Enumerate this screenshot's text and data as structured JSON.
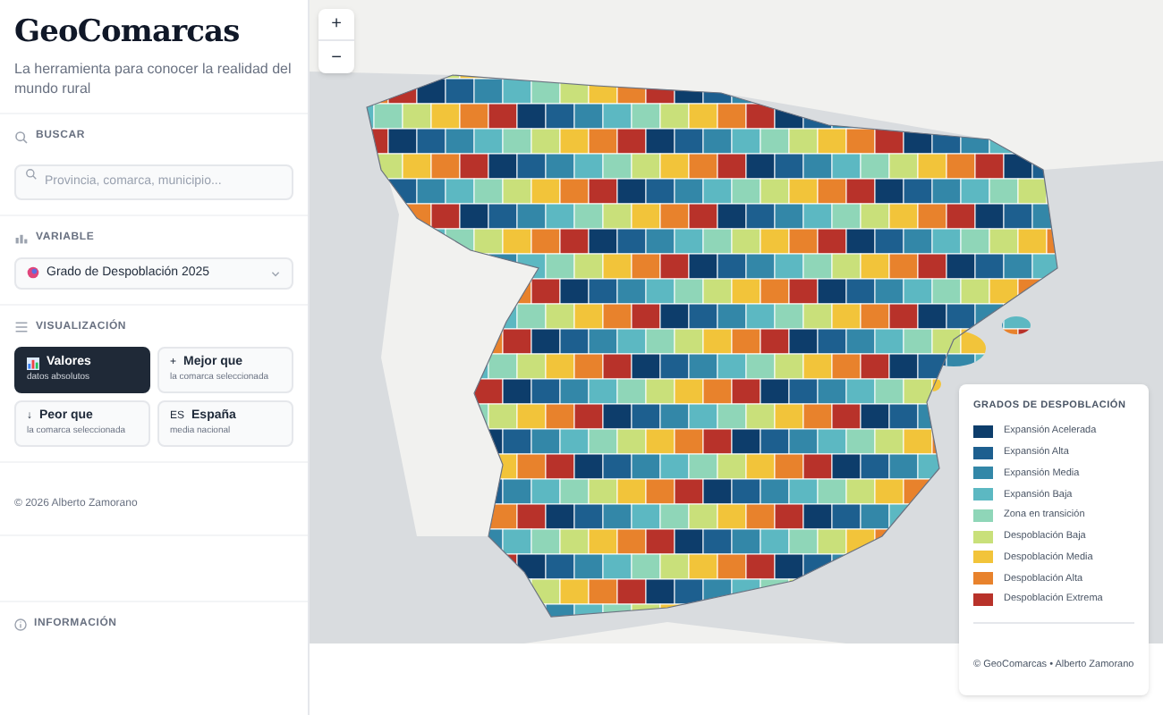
{
  "sidebar": {
    "title": "GeoComarcas",
    "subtitle": "La herramienta para conocer la realidad del mundo rural",
    "search": {
      "label": "BUSCAR",
      "placeholder": "Provincia, comarca, municipio..."
    },
    "variable": {
      "label": "VARIABLE",
      "value": "Grado de Despoblación 2025"
    },
    "visualization": {
      "label": "VISUALIZACIÓN",
      "options": [
        {
          "kind": "chart",
          "title": "Valores",
          "caption": "datos absolutos",
          "selected": true
        },
        {
          "kind": "glyph",
          "glyph": "+",
          "title": "Mejor que",
          "caption": "la comarca seleccionada",
          "selected": false
        },
        {
          "kind": "glyph",
          "glyph": "↓",
          "title": "Peor que",
          "caption": "la comarca seleccionada",
          "selected": false
        },
        {
          "kind": "glyph",
          "glyph": "ES",
          "title": "España",
          "caption": "media nacional",
          "selected": false
        }
      ]
    },
    "copyright": "© 2026 Alberto Zamorano",
    "info": "INFORMACIÓN"
  },
  "map": {
    "zoom_in": "+",
    "zoom_out": "−",
    "legend": {
      "title": "GRADOS DE DESPOBLACIÓN",
      "items": [
        {
          "label": "Expansión Acelerada",
          "color": "#0d3d6b"
        },
        {
          "label": "Expansión Alta",
          "color": "#1d5f8f"
        },
        {
          "label": "Expansión Media",
          "color": "#3387a8"
        },
        {
          "label": "Expansión Baja",
          "color": "#5cb8c2"
        },
        {
          "label": "Zona en transición",
          "color": "#8fd6b8"
        },
        {
          "label": "Despoblación Baja",
          "color": "#c9e07a"
        },
        {
          "label": "Despoblación Media",
          "color": "#f2c43a"
        },
        {
          "label": "Despoblación Alta",
          "color": "#e8822c"
        },
        {
          "label": "Despoblación Extrema",
          "color": "#b8322a"
        }
      ],
      "credit": "© GeoComarcas • Alberto Zamorano"
    }
  }
}
